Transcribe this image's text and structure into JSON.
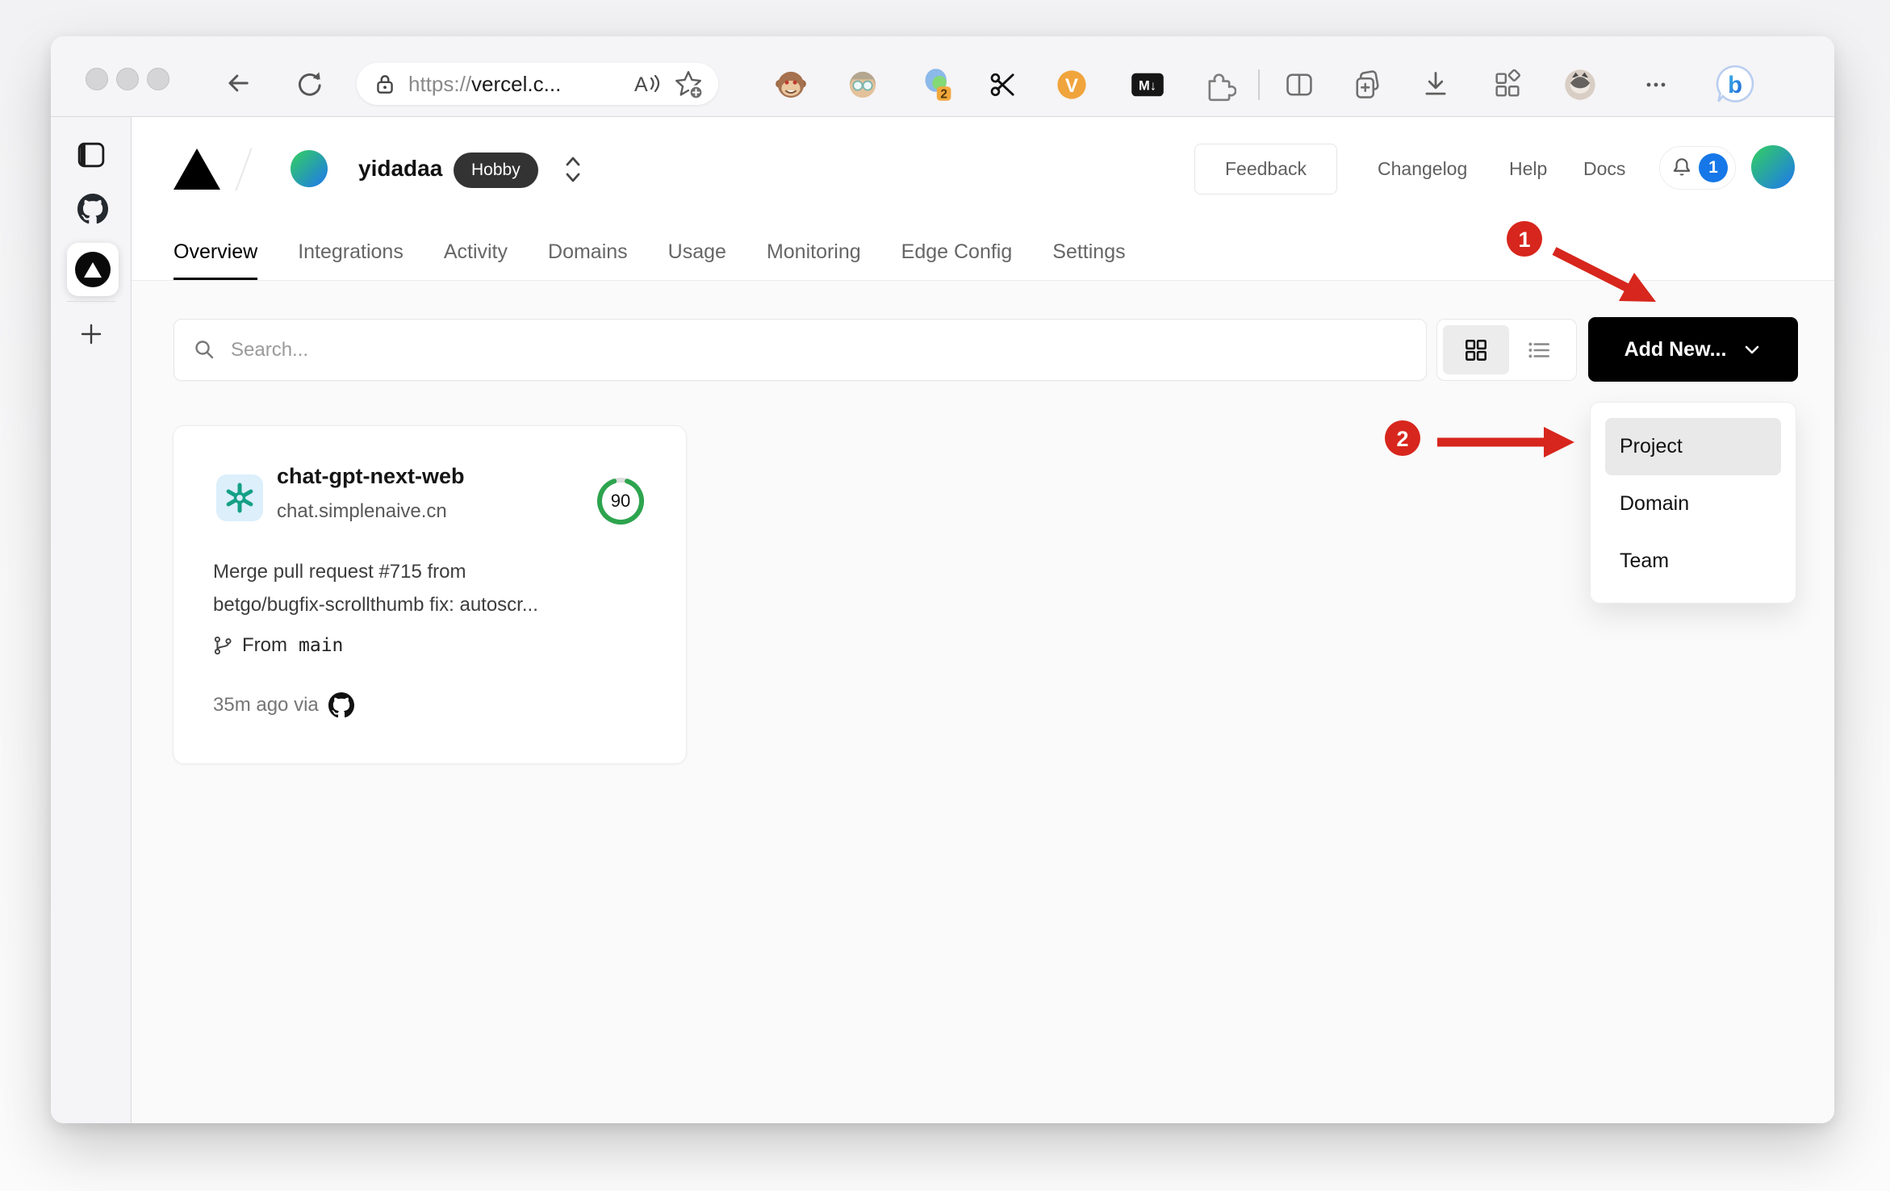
{
  "browser": {
    "url_protocol": "https://",
    "url_host": "vercel.c...",
    "extensions": {
      "tab_count_badge": "2",
      "markdown_label": "M↓",
      "video_label": "V",
      "bing_label": "b"
    }
  },
  "vercel": {
    "header": {
      "team_name": "yidadaa",
      "plan_badge": "Hobby",
      "feedback": "Feedback",
      "changelog": "Changelog",
      "help": "Help",
      "docs": "Docs",
      "notification_count": "1"
    },
    "tabs": [
      {
        "label": "Overview",
        "active": true
      },
      {
        "label": "Integrations",
        "active": false
      },
      {
        "label": "Activity",
        "active": false
      },
      {
        "label": "Domains",
        "active": false
      },
      {
        "label": "Usage",
        "active": false
      },
      {
        "label": "Monitoring",
        "active": false
      },
      {
        "label": "Edge Config",
        "active": false
      },
      {
        "label": "Settings",
        "active": false
      }
    ],
    "controls": {
      "search_placeholder": "Search...",
      "add_new_label": "Add New..."
    },
    "dropdown": {
      "items": [
        {
          "label": "Project",
          "selected": true
        },
        {
          "label": "Domain",
          "selected": false
        },
        {
          "label": "Team",
          "selected": false
        }
      ]
    },
    "project_card": {
      "name": "chat-gpt-next-web",
      "domain": "chat.simplenaive.cn",
      "score": "90",
      "commit_line1": "Merge pull request #715 from",
      "commit_line2": "betgo/bugfix-scrollthumb fix: autoscr...",
      "from_label": "From",
      "branch": "main",
      "deployed": "35m ago via"
    }
  },
  "annotations": {
    "step1": "1",
    "step2": "2"
  },
  "colors": {
    "annotation_red": "#d7261d",
    "score_green": "#2da44e",
    "notification_blue": "#1677e8",
    "add_new_black": "#000000",
    "avatar_gradient_start": "#34d05e",
    "avatar_gradient_end": "#1d76ef"
  }
}
